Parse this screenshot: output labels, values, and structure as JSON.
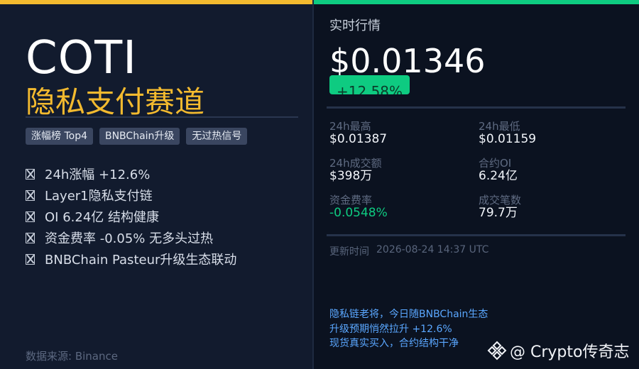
{
  "coin": {
    "title": "COTI",
    "subtitle": "隐私支付赛道",
    "tags": [
      "涨幅榜 Top4",
      "BNBChain升级",
      "无过热信号"
    ],
    "bullets": [
      "24h涨幅 +12.6%",
      "Layer1隐私支付链",
      "OI 6.24亿 结构健康",
      "资金费率 -0.05% 无多头过热",
      "BNBChain Pasteur升级生态联动"
    ],
    "source": "数据来源: Binance"
  },
  "market": {
    "section_label": "实时行情",
    "price": "$0.01346",
    "change": "+12.58%",
    "stats": {
      "high": {
        "label": "24h最高",
        "value": "$0.01387"
      },
      "low": {
        "label": "24h最低",
        "value": "$0.01159"
      },
      "volume": {
        "label": "24h成交额",
        "value": "$398万"
      },
      "open_interest": {
        "label": "合约OI",
        "value": "6.24亿"
      },
      "funding": {
        "label": "资金费率",
        "value": "-0.0548%"
      },
      "trades": {
        "label": "成交笔数",
        "value": "79.7万"
      }
    },
    "update_label": "更新时间",
    "update_time": "2026-08-24 14:37 UTC"
  },
  "commentary": [
    "隐私链老将，今日随BNBChain生态",
    "升级预期悄然拉升 +12.6%",
    "现货真实买入，合约结构干净"
  ],
  "watermark": {
    "icon": "binance-logo-icon",
    "text": "@ Crypto传奇志"
  },
  "colors": {
    "gold": "#f3ba2f",
    "green": "#0ecb81",
    "blue_text": "#5aa7ff",
    "left_bg": "#121b2e",
    "right_bg": "#0b1220"
  }
}
